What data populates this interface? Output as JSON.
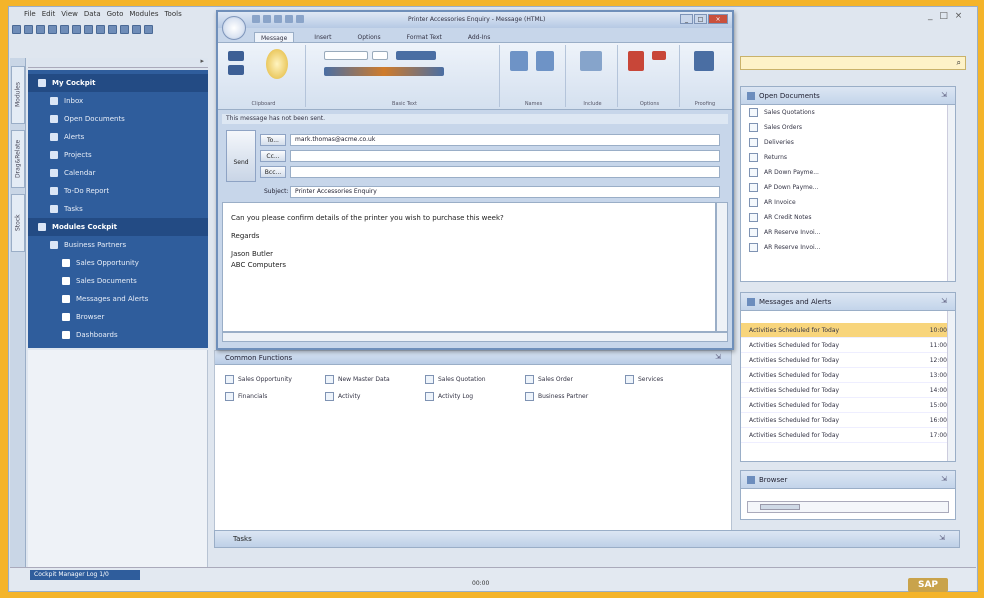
{
  "host": {
    "menu": [
      "File",
      "Edit",
      "View",
      "Data",
      "Goto",
      "Modules",
      "Tools"
    ],
    "window_controls": "_ □ ×",
    "side_tabs": [
      "Modules",
      "Drag&Relate",
      "Stock"
    ],
    "nav": {
      "items": [
        {
          "label": "My Cockpit",
          "type": "head"
        },
        {
          "label": "Inbox",
          "type": "item"
        },
        {
          "label": "Open Documents",
          "type": "item"
        },
        {
          "label": "Alerts",
          "type": "item"
        },
        {
          "label": "Projects",
          "type": "item"
        },
        {
          "label": "Calendar",
          "type": "item"
        },
        {
          "label": "To-Do Report",
          "type": "item"
        },
        {
          "label": "Tasks",
          "type": "item"
        },
        {
          "label": "Modules Cockpit",
          "type": "head"
        },
        {
          "label": "Business Partners",
          "type": "sub"
        },
        {
          "label": "Sales Opportunity",
          "type": "subsub"
        },
        {
          "label": "Sales Documents",
          "type": "subsub"
        },
        {
          "label": "Messages and Alerts",
          "type": "subsub"
        },
        {
          "label": "Browser",
          "type": "subsub"
        },
        {
          "label": "Dashboards",
          "type": "subsub"
        }
      ]
    },
    "common_functions": {
      "title": "Common Functions",
      "links": [
        "Sales Opportunity",
        "New Master Data",
        "Sales Quotation",
        "Sales Order",
        "Services",
        "Financials",
        "Activity",
        "Activity Log",
        "Business Partner"
      ]
    },
    "tasks_bar": "Tasks",
    "status_tab": "Cockpit Manager Log 1/0",
    "status_center": "00:00",
    "sap_logo": "SAP",
    "search_placeholder": "",
    "open_documents": {
      "title": "Open Documents",
      "items": [
        "Sales Quotations",
        "Sales Orders",
        "Deliveries",
        "Returns",
        "AR Down Payme...",
        "AP Down Payme...",
        "AR Invoice",
        "AR Credit Notes",
        "AR Reserve Invoi...",
        "AR Reserve Invoi..."
      ]
    },
    "messages": {
      "title": "Messages and Alerts",
      "rows": [
        {
          "text": "Activities Scheduled for Today",
          "time": "10:00",
          "hl": true
        },
        {
          "text": "Activities Scheduled for Today",
          "time": "11:00",
          "hl": false
        },
        {
          "text": "Activities Scheduled for Today",
          "time": "12:00",
          "hl": false
        },
        {
          "text": "Activities Scheduled for Today",
          "time": "13:00",
          "hl": false
        },
        {
          "text": "Activities Scheduled for Today",
          "time": "14:00",
          "hl": false
        },
        {
          "text": "Activities Scheduled for Today",
          "time": "15:00",
          "hl": false
        },
        {
          "text": "Activities Scheduled for Today",
          "time": "16:00",
          "hl": false
        },
        {
          "text": "Activities Scheduled for Today",
          "time": "17:00",
          "hl": false
        }
      ]
    },
    "browser": {
      "title": "Browser"
    }
  },
  "email": {
    "title": "Printer Accessories Enquiry - Message (HTML)",
    "tabs": [
      "Message",
      "Insert",
      "Options",
      "Format Text",
      "Add-Ins"
    ],
    "ribbon_groups": [
      "Clipboard",
      "Basic Text",
      "Names",
      "Include",
      "Options",
      "Proofing"
    ],
    "infobar": "This message has not been sent.",
    "to_label": "To...",
    "cc_label": "Cc...",
    "bcc_label": "Bcc...",
    "send_label": "Send",
    "to_value": "mark.thomas@acme.co.uk",
    "cc_value": "",
    "bcc_value": "",
    "subject_label": "Subject:",
    "subject_value": "Printer Accessories Enquiry",
    "body": {
      "line1": "Can you please confirm details of the printer you wish to purchase this week?",
      "line2": "Regards",
      "line3": "Jason Butler",
      "line4": "ABC Computers"
    }
  }
}
